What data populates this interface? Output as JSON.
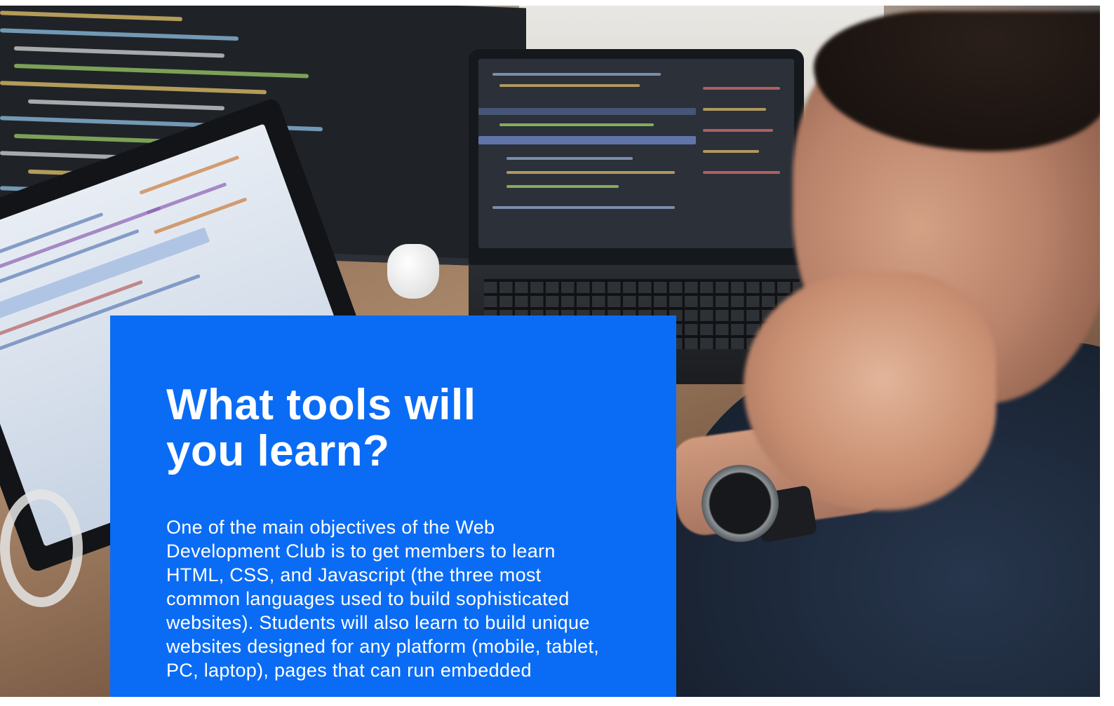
{
  "section": {
    "title": "What tools will you learn?",
    "body": "One of the main objectives of the Web Development Club is to get members to learn HTML, CSS, and Javascript (the three most common languages used to build sophisticated websites). Students will also learn to build unique websites designed for any platform (mobile, tablet, PC, laptop), pages that can run embedded"
  },
  "colors": {
    "card_background": "#0a6cf5",
    "text": "#ffffff"
  }
}
